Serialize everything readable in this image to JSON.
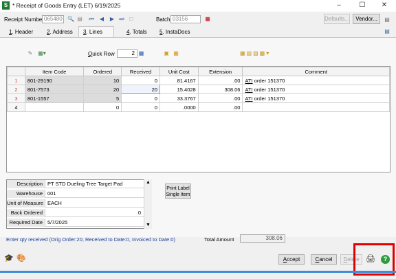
{
  "window": {
    "title": "* Receipt of Goods Entry (LET) 6/19/2025",
    "app_icon": "S",
    "minimize": "–",
    "maximize": "☐",
    "close": "✕"
  },
  "header": {
    "receipt_number_label": "Receipt Number",
    "receipt_number_value": "065480",
    "batch_label": "Batch",
    "batch_value": "03156",
    "defaults_label": "Defaults...",
    "vendor_label": "Vendor..."
  },
  "tabs": [
    {
      "num": "1",
      "label": ". Header"
    },
    {
      "num": "2",
      "label": ". Address"
    },
    {
      "num": "3",
      "label": ". Lines"
    },
    {
      "num": "4",
      "label": ". Totals"
    },
    {
      "num": "5",
      "label": ". InstaDocs"
    }
  ],
  "toolbar": {
    "quick_row_label": "Quick Row",
    "quick_row_value": "2"
  },
  "grid": {
    "columns": [
      "Item Code",
      "Ordered",
      "Received",
      "Unit Cost",
      "Extension",
      "Comment"
    ],
    "rows": [
      {
        "n": "1",
        "item": "801-29190",
        "ordered": "10",
        "received": "0",
        "unit_cost": "81.4167",
        "extension": ".00",
        "comment_prefix": "ATI",
        "comment": " order 151370"
      },
      {
        "n": "2",
        "item": "801-7573",
        "ordered": "20",
        "received": "20",
        "unit_cost": "15.4028",
        "extension": "308.06",
        "comment_prefix": "ATI",
        "comment": " order 151370"
      },
      {
        "n": "3",
        "item": "801-1557",
        "ordered": "5",
        "received": "0",
        "unit_cost": "33.3767",
        "extension": ".00",
        "comment_prefix": "ATI",
        "comment": " order 151370"
      },
      {
        "n": "4",
        "item": "",
        "ordered": "0",
        "received": "0",
        "unit_cost": ".0000",
        "extension": ".00",
        "comment_prefix": "",
        "comment": ""
      }
    ]
  },
  "details": [
    {
      "label": "Description",
      "value": "PT STD Dueling Tree Target Pad"
    },
    {
      "label": "Warehouse",
      "value": "001"
    },
    {
      "label": "Unit of Measure",
      "value": "EACH"
    },
    {
      "label": "Back Ordered",
      "value": "0"
    },
    {
      "label": "Required Date",
      "value": "5/7/2025"
    }
  ],
  "print_label": {
    "line1": "Print Label",
    "line2": "Single Item"
  },
  "status": {
    "message": "Enter qty received (Orig Order:20, Received to Date:0, Invoiced to Date:0)",
    "total_amount_label": "Total Amount",
    "total_amount_value": "308.06"
  },
  "footer": {
    "accept_label": "Accept",
    "cancel_label": "Cancel",
    "delete_label": "Delete"
  },
  "colors": {
    "status_text": "#1b3f9c",
    "highlight_box": "#e00000",
    "accent_bar": "#3b8fd8"
  },
  "icons": [
    "app-icon",
    "search-icon",
    "copy-icon",
    "first-icon",
    "prev-icon",
    "next-icon",
    "last-icon",
    "delete-icon",
    "batch-icon",
    "sidebar-icon",
    "dropper-icon",
    "grid-menu-icon",
    "quick-row-icon",
    "notes-icon",
    "spreadsheet-icon",
    "grid-tool-icons",
    "graduation-icon",
    "palette-icon",
    "printer-icon",
    "help-icon"
  ]
}
